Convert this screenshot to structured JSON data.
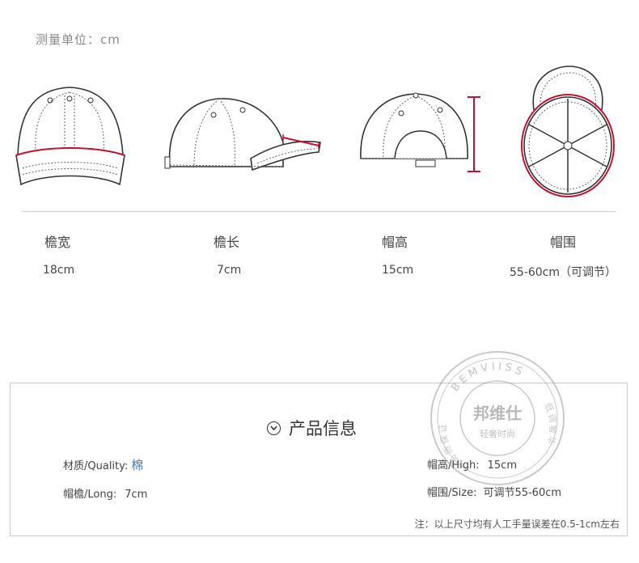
{
  "header": {
    "unit_label": "测量单位：cm"
  },
  "measurements": [
    {
      "name": "檐宽",
      "value": "18cm"
    },
    {
      "name": "檐长",
      "value": "7cm"
    },
    {
      "name": "帽高",
      "value": "15cm"
    },
    {
      "name": "帽围",
      "value": "55-60cm（可调节）"
    }
  ],
  "product_info": {
    "title": "产品信息",
    "material_label": "材质/Quality:",
    "material_value": "棉",
    "brim_label": "帽檐/Long:",
    "brim_value": "7cm",
    "height_label": "帽高/High:",
    "height_value": "15cm",
    "size_label": "帽围/Size:",
    "size_value": "可调节55-60cm",
    "note": "注：以上尺寸均有人工手量误差在0.5-1cm左右"
  },
  "watermark": {
    "brand_top": "BEMVIISS",
    "brand_cn": "邦维仕",
    "slogan": "轻奢时尚",
    "side_text_left": "品质保证",
    "side_text_right": "低调奢华"
  },
  "colors": {
    "accent_red": "#c8102e",
    "link_blue": "#3a7bd5"
  }
}
